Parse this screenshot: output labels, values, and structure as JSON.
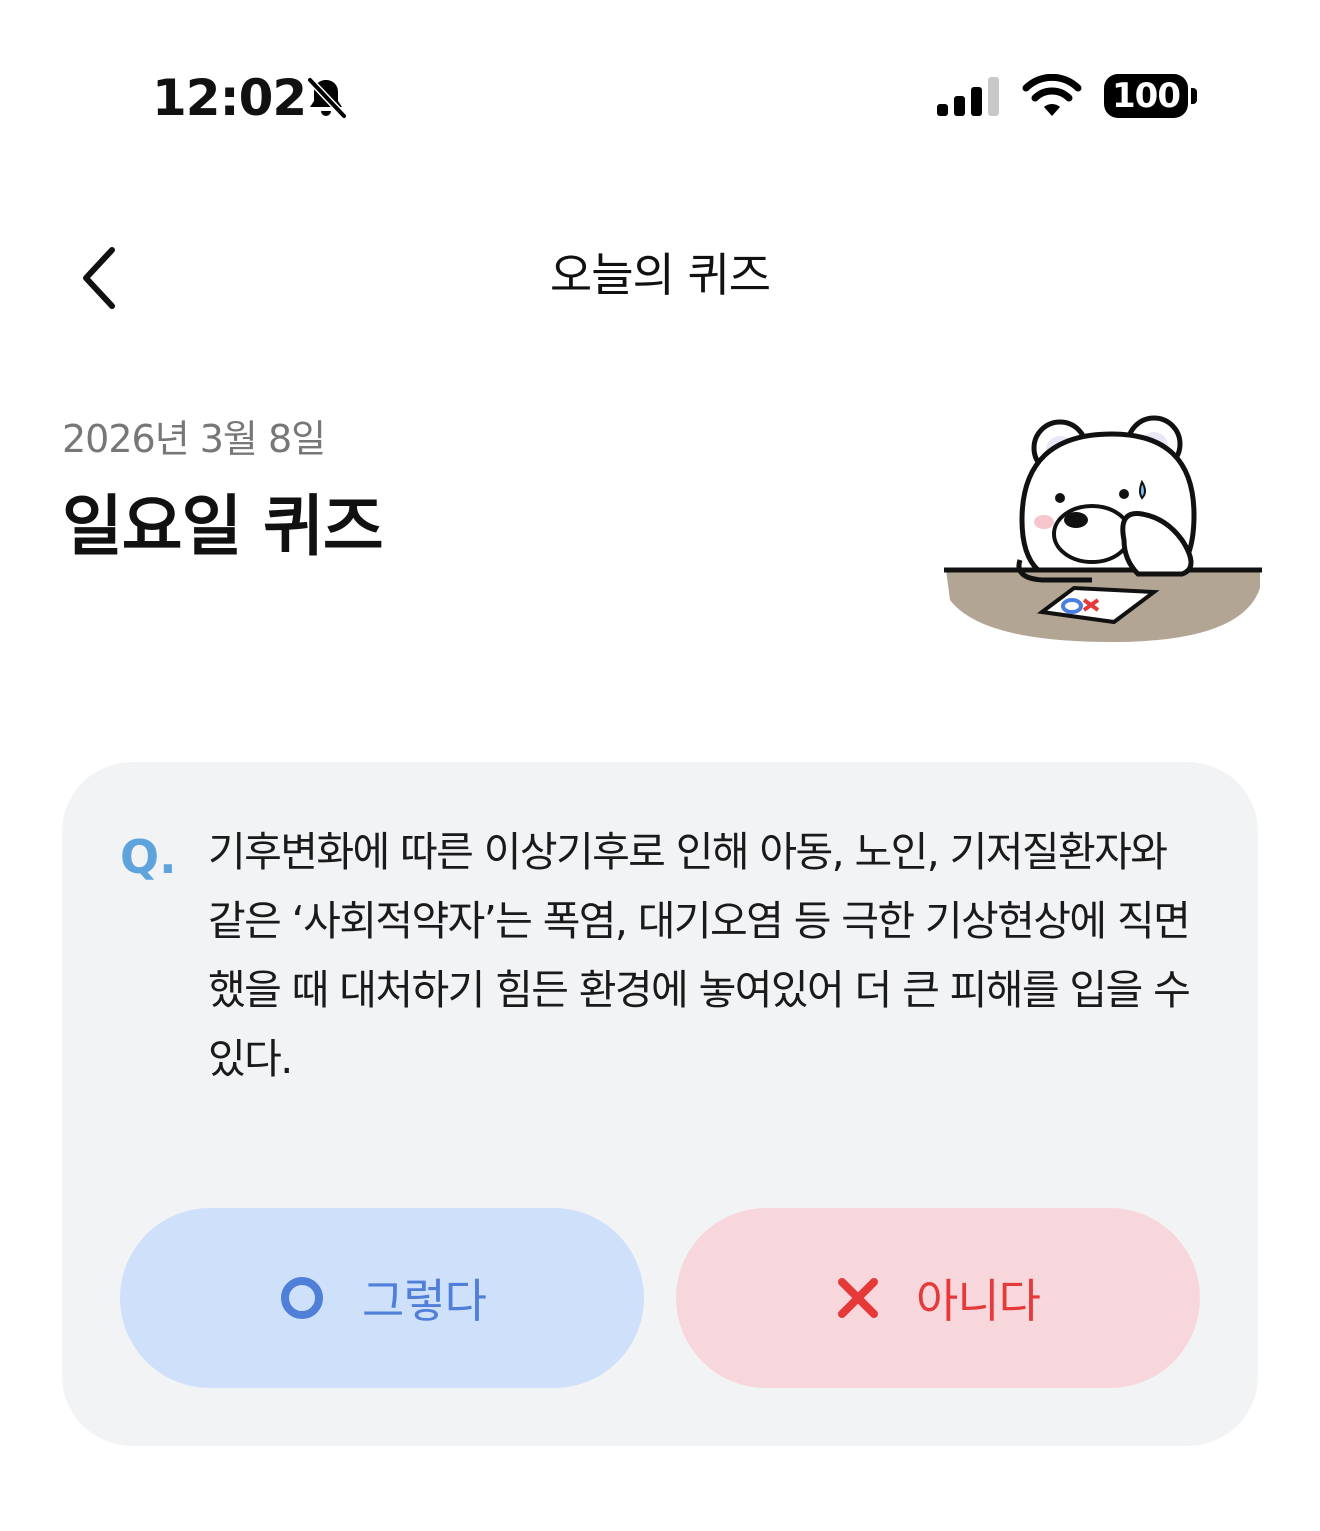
{
  "status_bar": {
    "time": "12:02",
    "battery": "100",
    "icons": [
      "bell-slash-icon",
      "signal-icon",
      "wifi-icon",
      "battery-icon"
    ]
  },
  "nav": {
    "title": "오늘의 퀴즈",
    "back_icon": "chevron-left-icon"
  },
  "header": {
    "date": "2026년 3월 8일",
    "title": "일요일 퀴즈",
    "illustration": "bear-with-ox-paper"
  },
  "question": {
    "marker": "Q.",
    "text": "기후변화에 따른 이상기후로 인해 아동, 노인, 기저질환자와 같은 ‘사회적약자’는 폭염, 대기오염 등 극한 기상현상에 직면했을 때 대처하기 힘든 환경에 놓여있어 더 큰 피해를 입을 수 있다."
  },
  "answers": {
    "yes_label": "그렇다",
    "no_label": "아니다",
    "yes_icon": "circle-o-icon",
    "no_icon": "x-mark-icon"
  },
  "colors": {
    "card_bg": "#f2f3f5",
    "yes_bg": "#cfe0fa",
    "yes_fg": "#4f7fd9",
    "no_bg": "#f8d7dc",
    "no_fg": "#e63a3a",
    "q_marker": "#5ea3dc"
  }
}
